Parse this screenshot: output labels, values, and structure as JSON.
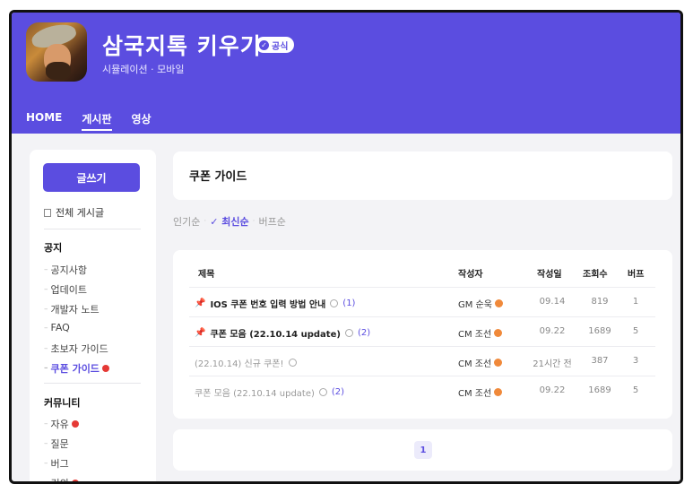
{
  "header": {
    "title": "삼국지톡 키우기",
    "badge": "공식",
    "subtitle": "시뮬레이션 · 모바일",
    "nav": [
      "HOME",
      "게시판",
      "영상"
    ]
  },
  "sidebar": {
    "write_button": "글쓰기",
    "all_posts": "전체 게시글",
    "notice_section": "공지",
    "notice_items": [
      "공지사항",
      "업데이트",
      "개발자 노트",
      "FAQ",
      "초보자 가이드",
      "쿠폰 가이드"
    ],
    "community_section": "커뮤니티",
    "community_items": [
      "자유",
      "질문",
      "버그",
      "건의"
    ]
  },
  "board": {
    "title": "쿠폰 가이드",
    "sort": [
      "인기순",
      "최신순",
      "버프순"
    ],
    "columns": [
      "제목",
      "작성자",
      "작성일",
      "조회수",
      "버프"
    ],
    "rows": [
      {
        "title": "IOS 쿠폰 번호 입력 방법 안내",
        "comments": "(1)",
        "author": "GM 순욱",
        "date": "09.14",
        "views": "819",
        "buff": "1"
      },
      {
        "title": "쿠폰 모음 (22.10.14 update)",
        "comments": "(2)",
        "author": "CM 조선",
        "date": "09.22",
        "views": "1689",
        "buff": "5"
      },
      {
        "title": "(22.10.14) 신규 쿠폰!",
        "comments": "",
        "author": "CM 조선",
        "date": "21시간 전",
        "views": "387",
        "buff": "3"
      },
      {
        "title": "쿠폰 모음 (22.10.14 update)",
        "comments": "(2)",
        "author": "CM 조선",
        "date": "09.22",
        "views": "1689",
        "buff": "5"
      }
    ],
    "page": "1"
  },
  "colors": {
    "accent": "#5b4de0",
    "new": "#e53935",
    "level": "#f0893a"
  },
  "icons": {
    "pin": "pin-icon",
    "check": "check-icon",
    "eye": "view-icon",
    "new": "new-dot-icon"
  }
}
